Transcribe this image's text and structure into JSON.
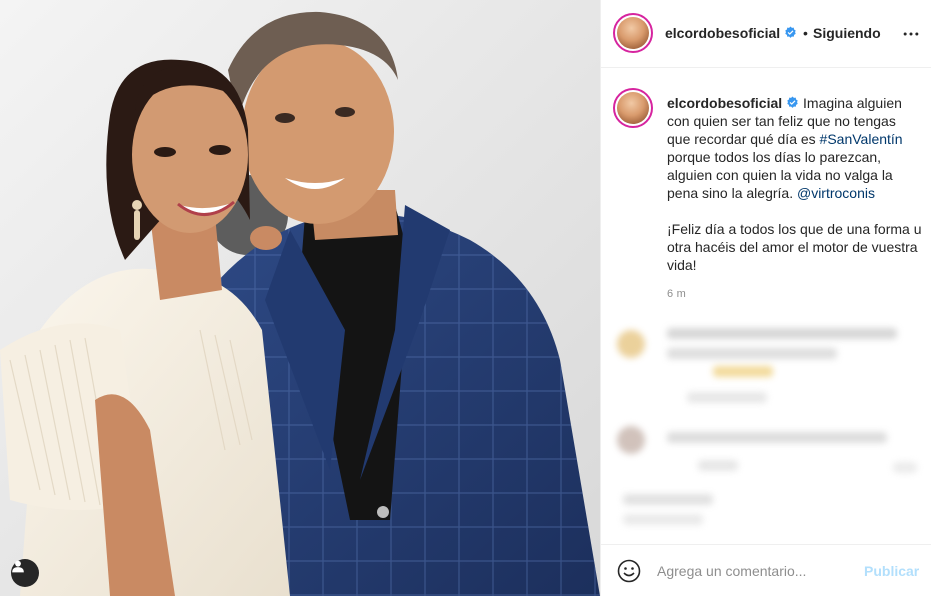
{
  "post": {
    "username": "elcordobesoficial",
    "follow_separator": "•",
    "follow_state": "Siguiendo",
    "caption_intro": "Imagina alguien con quien ser tan feliz que no tengas que recordar qué día es ",
    "caption_hashtag": "#SanValentín",
    "caption_middle": " porque todos los días lo parezcan, alguien con quien la vida no valga la pena sino la alegría. ",
    "caption_mention": "@virtroconis",
    "caption_second": "¡Feliz día a todos los que de una forma u otra hacéis del amor el motor de vuestra vida!",
    "time_ago": "6 m"
  },
  "comment_box": {
    "placeholder": "Agrega un comentario...",
    "publish_label": "Publicar"
  },
  "icons": {
    "verified": "verified-badge-icon",
    "more": "more-options-icon",
    "emoji": "emoji-icon",
    "tag": "user-tag-icon"
  },
  "colors": {
    "verified_blue": "#3897f0",
    "link": "#00376b",
    "publish_disabled": "#b2dffc",
    "muted": "#8e8e8e"
  }
}
